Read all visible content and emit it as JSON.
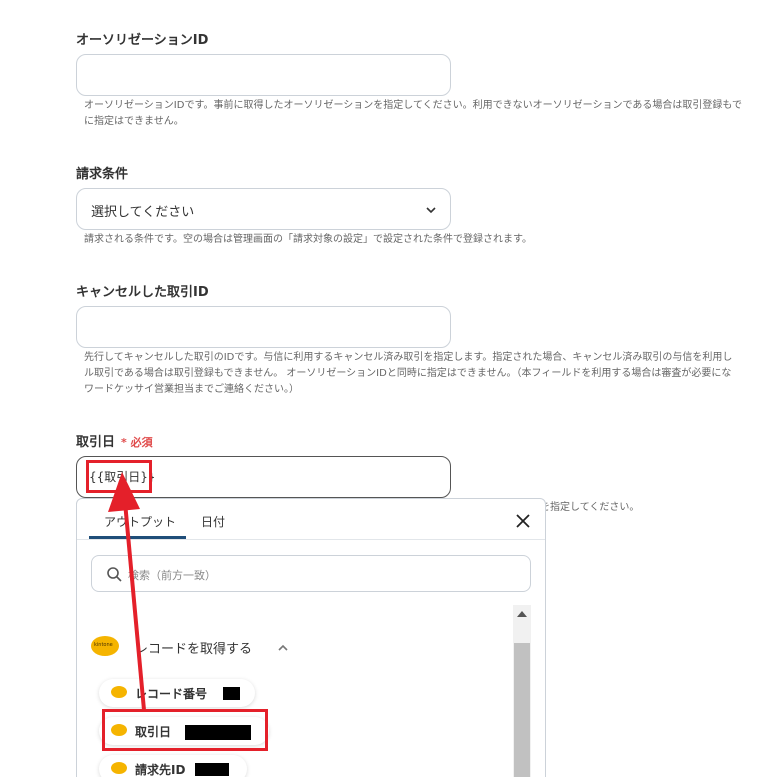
{
  "fields": {
    "authorization": {
      "label": "オーソリゼーションID",
      "value": "",
      "help_line1": "オーソリゼーションIDです。事前に取得したオーソリゼーションを指定してください。利用できないオーソリゼーションである場合は取引登録もで",
      "help_line2": "に指定はできません。"
    },
    "billing": {
      "label": "請求条件",
      "selected": "選択してください",
      "help": "請求される条件です。空の場合は管理画面の「請求対象の設定」で設定された条件で登録されます。"
    },
    "cancel": {
      "label": "キャンセルした取引ID",
      "value": "",
      "help_line1": "先行してキャンセルした取引のIDです。与信に利用するキャンセル済み取引を指定します。指定された場合、キャンセル済み取引の与信を利用し",
      "help_line2": "ル取引である場合は取引登録もできません。 オーソリゼーションIDと同時に指定はできません。（本フィールドを利用する場合は審査が必要にな",
      "help_line3": "ワードケッサイ営業担当までご連絡ください。）"
    },
    "trade_date": {
      "label": "取引日",
      "required_mark": "*",
      "required_text": "必須",
      "value": "{{取引日}}",
      "help_tail": "を指定してください。"
    }
  },
  "panel": {
    "tabs": [
      {
        "label": "アウトプット",
        "active": true
      },
      {
        "label": "日付",
        "active": false
      }
    ],
    "search_placeholder": "検索（前方一致）",
    "group": {
      "badge": "kintone",
      "label": "レコードを取得する"
    },
    "items": [
      {
        "label": "レコード番号"
      },
      {
        "label": "取引日"
      },
      {
        "label": "請求先ID"
      }
    ]
  },
  "colors": {
    "highlight": "#e4202a",
    "tab_underline": "#1f4e79",
    "required": "#e04b4b",
    "kintone": "#f5b400"
  },
  "icons": [
    "chevron-down-icon",
    "close-icon",
    "search-icon",
    "chevron-up-icon",
    "kintone-icon"
  ]
}
